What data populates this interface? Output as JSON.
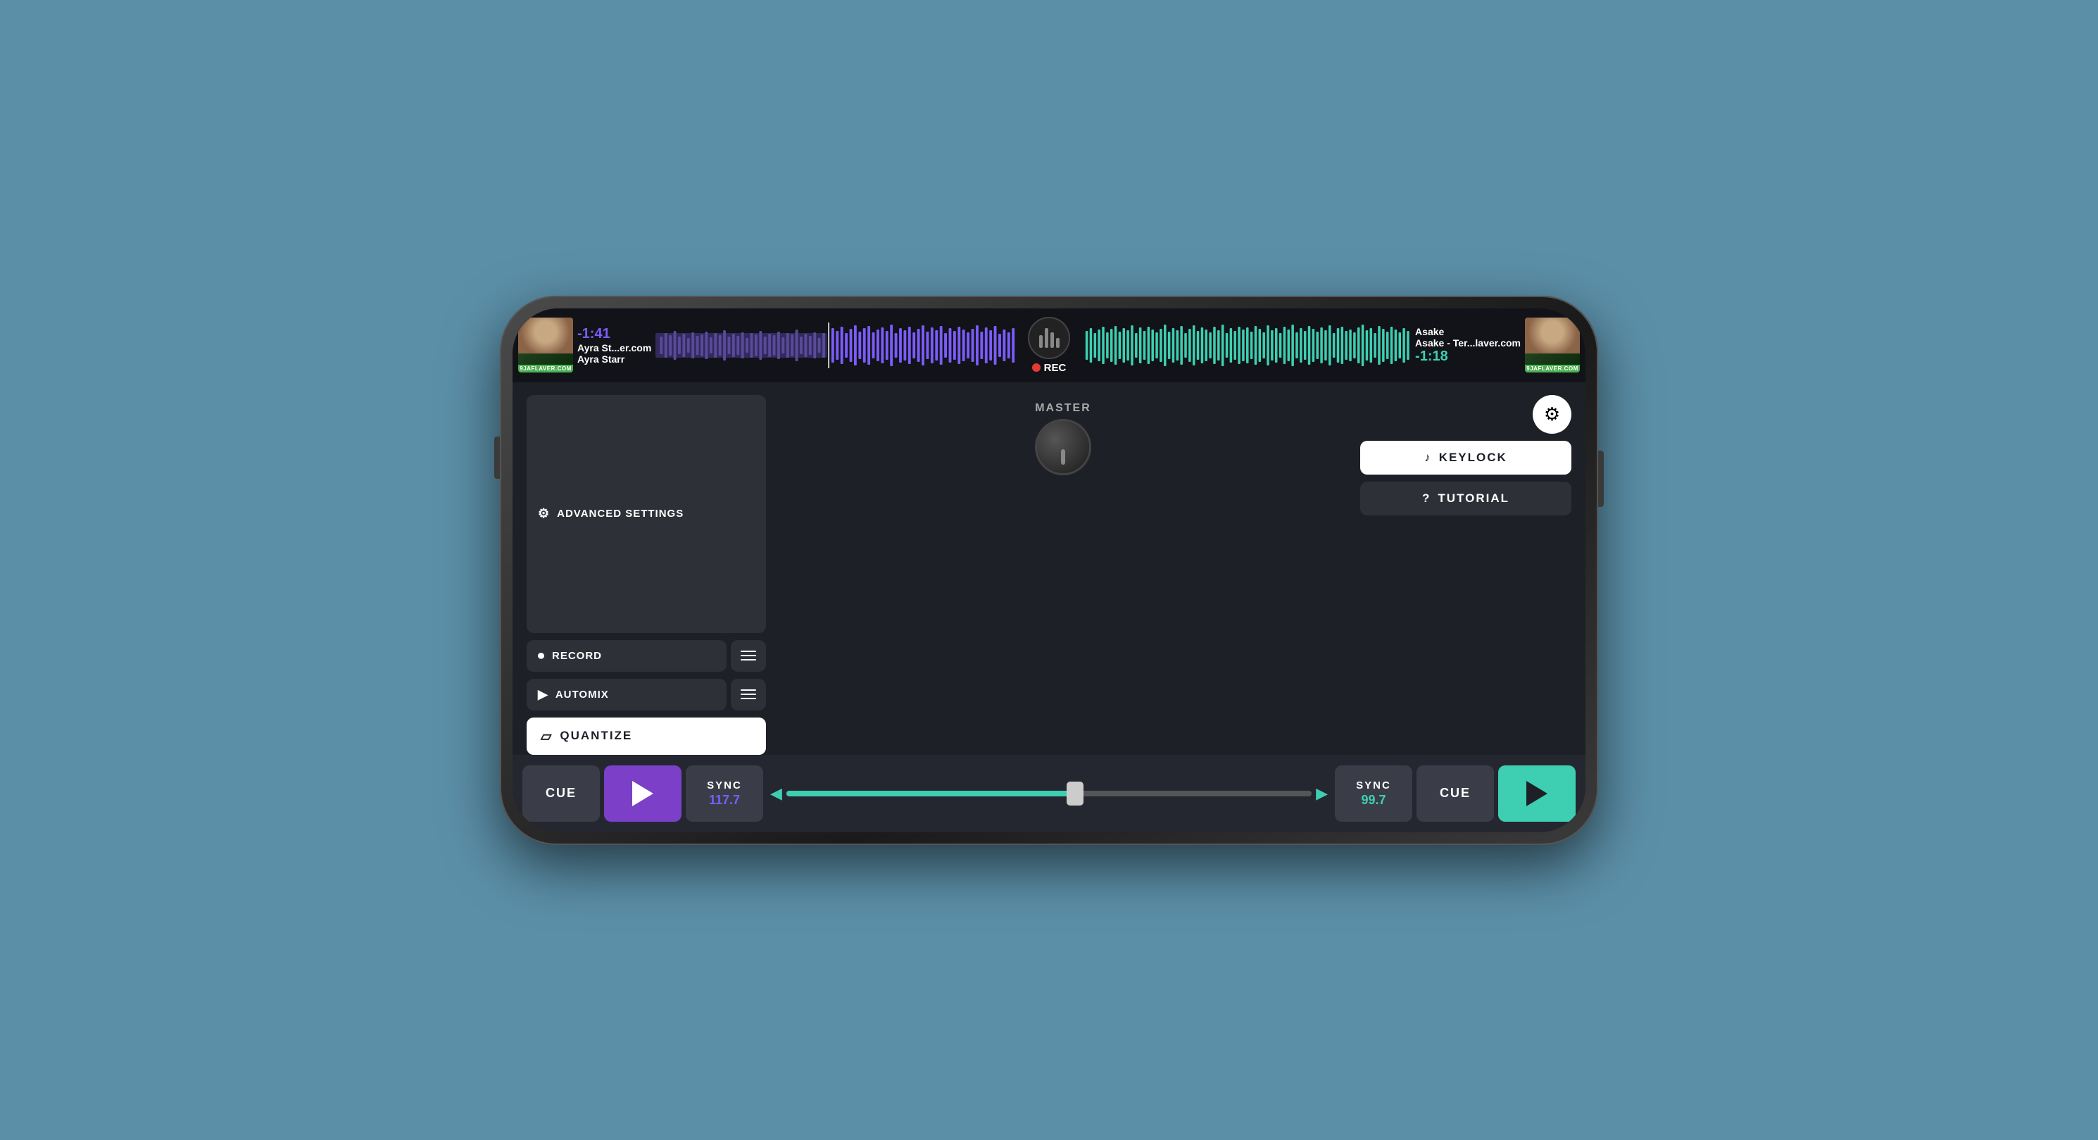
{
  "phone": {
    "screen": {
      "top_bar": {
        "left_deck": {
          "time": "-1:41",
          "title": "Ayra St...er.com",
          "artist": "Ayra Starr",
          "badge": "9JAFLAVER.COM"
        },
        "center": {
          "rec_label": "REC"
        },
        "right_deck": {
          "time": "-1:18",
          "title": "Asake",
          "subtitle": "Asake - Ter...laver.com",
          "badge": "9JAFLAVER.COM"
        }
      },
      "main": {
        "advanced_settings_label": "ADVANCED SETTINGS",
        "record_label": "RECORD",
        "automix_label": "AUTOMIX",
        "quantize_label": "QUANTIZE",
        "master_label": "MASTER",
        "keylock_label": "KEYLOCK",
        "tutorial_label": "TUTORIAL"
      },
      "bottom_bar": {
        "left_cue_label": "CUE",
        "left_sync_label": "SYNC",
        "left_bpm": "117.7",
        "right_sync_label": "SYNC",
        "right_bpm": "99.7",
        "right_cue_label": "CUE"
      }
    }
  }
}
